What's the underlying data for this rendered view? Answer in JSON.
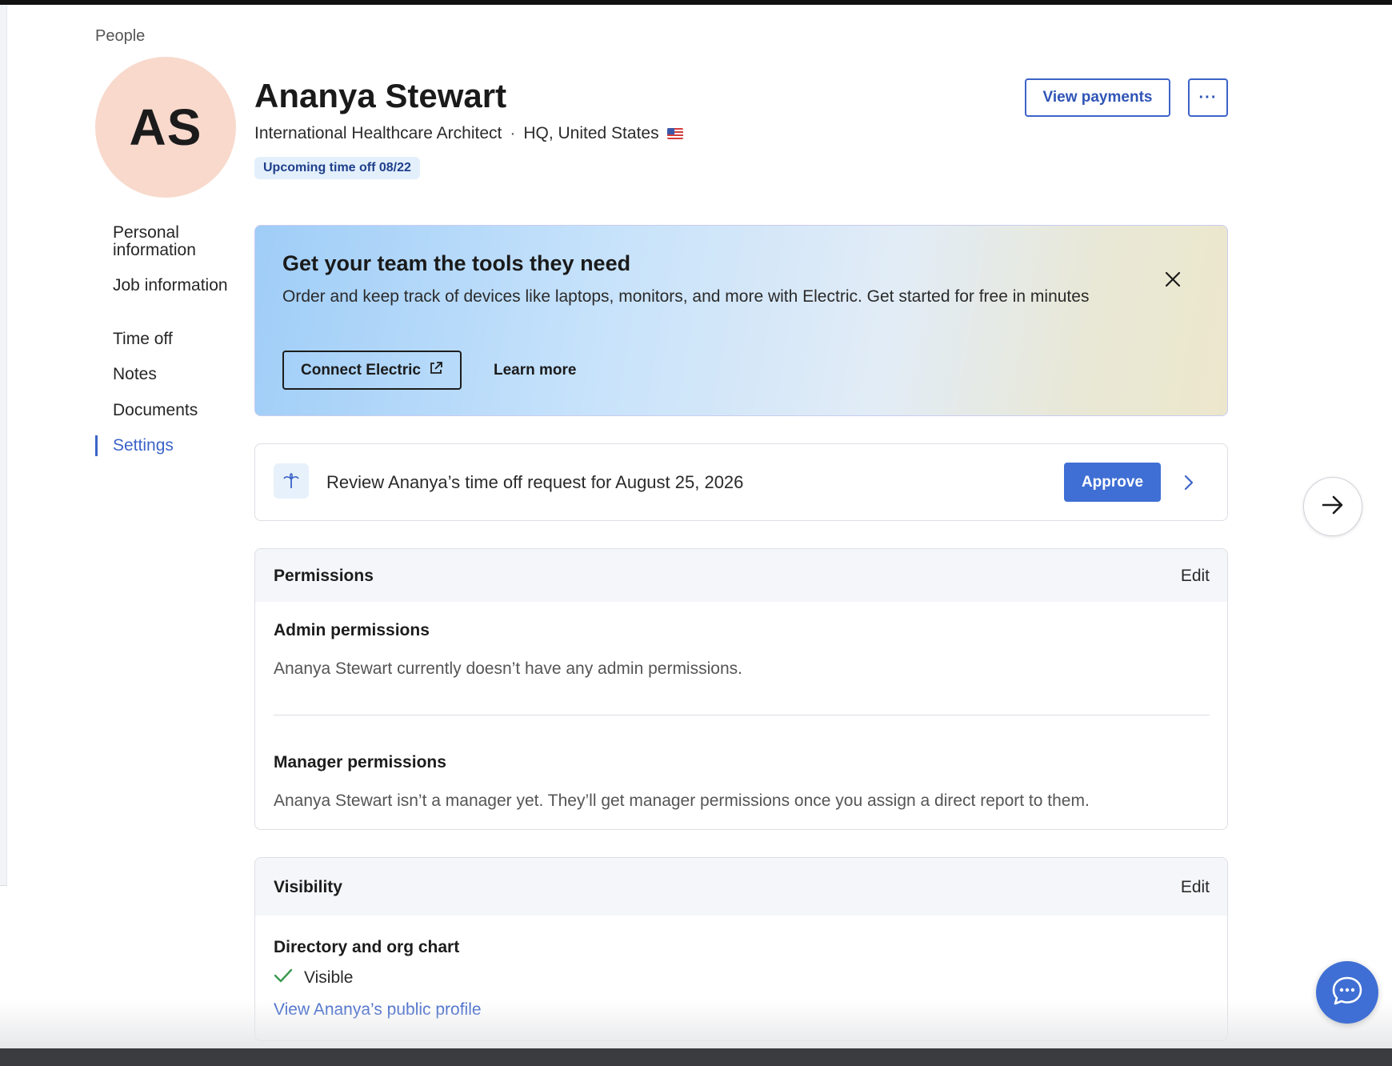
{
  "breadcrumb": {
    "label": "People"
  },
  "profile": {
    "initials": "AS",
    "name": "Ananya Stewart",
    "title": "International Healthcare Architect",
    "separator": "·",
    "location": "HQ, United States",
    "badge": "Upcoming time off 08/22"
  },
  "header_actions": {
    "view_payments": "View payments",
    "more": "···"
  },
  "sidenav": {
    "items": [
      {
        "label": "Personal information",
        "active": false
      },
      {
        "label": "Job information",
        "active": false
      },
      {
        "label": "Time off",
        "active": false
      },
      {
        "label": "Notes",
        "active": false
      },
      {
        "label": "Documents",
        "active": false
      },
      {
        "label": "Settings",
        "active": true
      }
    ]
  },
  "promo": {
    "title": "Get your team the tools they need",
    "text": "Order and keep track of devices like laptops, monitors, and more with Electric. Get started for free in minutes",
    "connect_label": "Connect Electric",
    "learn_more_label": "Learn more"
  },
  "review": {
    "text": "Review Ananya’s time off request for August 25, 2026",
    "approve_label": "Approve"
  },
  "permissions": {
    "title": "Permissions",
    "edit_label": "Edit",
    "admin_heading": "Admin permissions",
    "admin_text": "Ananya Stewart currently doesn’t have any admin permissions.",
    "manager_heading": "Manager permissions",
    "manager_text": "Ananya Stewart isn’t a manager yet. They’ll get manager permissions once you assign a direct report to them."
  },
  "visibility": {
    "title": "Visibility",
    "edit_label": "Edit",
    "directory_heading": "Directory and org chart",
    "status": "Visible",
    "profile_link": "View Ananya’s public profile"
  },
  "colors": {
    "accent": "#3c64c8",
    "approve": "#3f6fd4",
    "avatar_bg": "#f8d9cc",
    "badge_bg": "#e3f0fc",
    "check": "#3a9a4f"
  },
  "icons": [
    "flag-us-icon",
    "close-icon",
    "external-link-icon",
    "palm-tree-icon",
    "chevron-right-icon",
    "arrow-right-icon",
    "check-icon",
    "chat-icon"
  ]
}
